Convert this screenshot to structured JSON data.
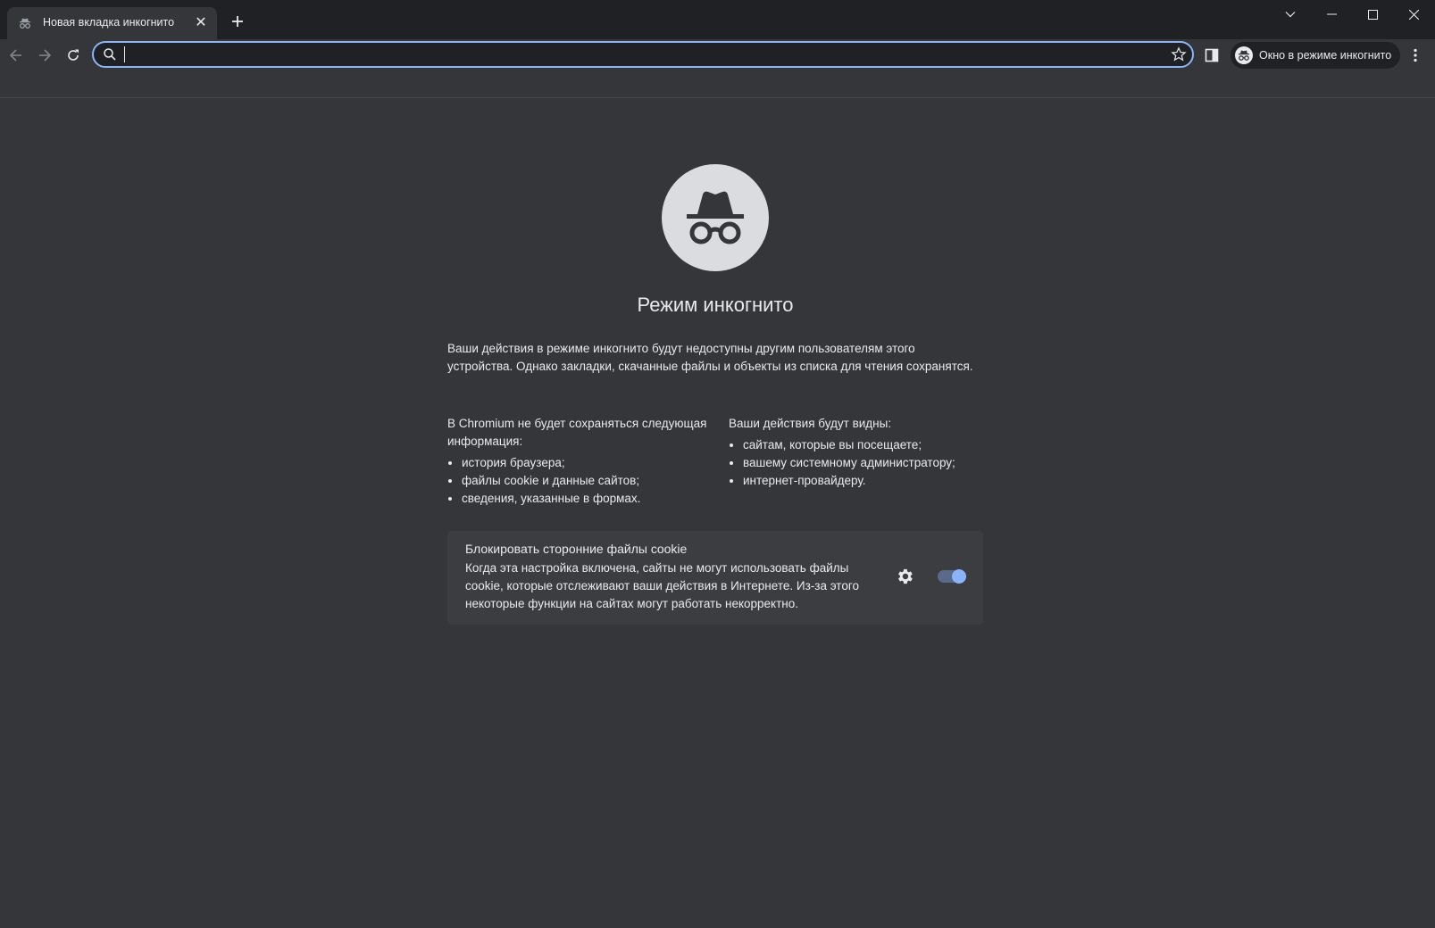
{
  "tab": {
    "title": "Новая вкладка инкогнито",
    "close": "✕",
    "new_tab": "+"
  },
  "toolbar": {
    "omnibox_value": "",
    "incognito_chip_label": "Окно в режиме инкогнито"
  },
  "page": {
    "title": "Режим инкогнито",
    "intro": "Ваши действия в режиме инкогнито будут недоступны другим пользователям этого устройства. Однако закладки, скачанные файлы и объекты из списка для чтения сохранятся.",
    "left_heading": "В Chromium не будет сохраняться следующая информация:",
    "left_items": [
      "история браузера;",
      "файлы cookie и данные сайтов;",
      "сведения, указанные в формах."
    ],
    "right_heading": "Ваши действия будут видны:",
    "right_items": [
      "сайтам, которые вы посещаете;",
      "вашему системному администратору;",
      "интернет-провайдеру."
    ]
  },
  "cookie_card": {
    "title": "Блокировать сторонние файлы cookie",
    "description": "Когда эта настройка включена, сайты не могут использовать файлы cookie, которые отслеживают ваши действия в Интернете. Из-за этого некоторые функции на сайтах могут работать некорректно.",
    "toggle_on": true
  },
  "icons": [
    "incognito-icon",
    "close-icon",
    "plus-icon",
    "chevron-down-icon",
    "minimize-icon",
    "maximize-icon",
    "back-icon",
    "forward-icon",
    "reload-icon",
    "search-icon",
    "star-icon",
    "side-panel-icon",
    "kebab-menu-icon",
    "gear-icon"
  ],
  "colors": {
    "frame": "#202124",
    "surface": "#35363a",
    "card": "#3c3d41",
    "accent": "#8ab4f8",
    "text": "#e8eaed"
  }
}
